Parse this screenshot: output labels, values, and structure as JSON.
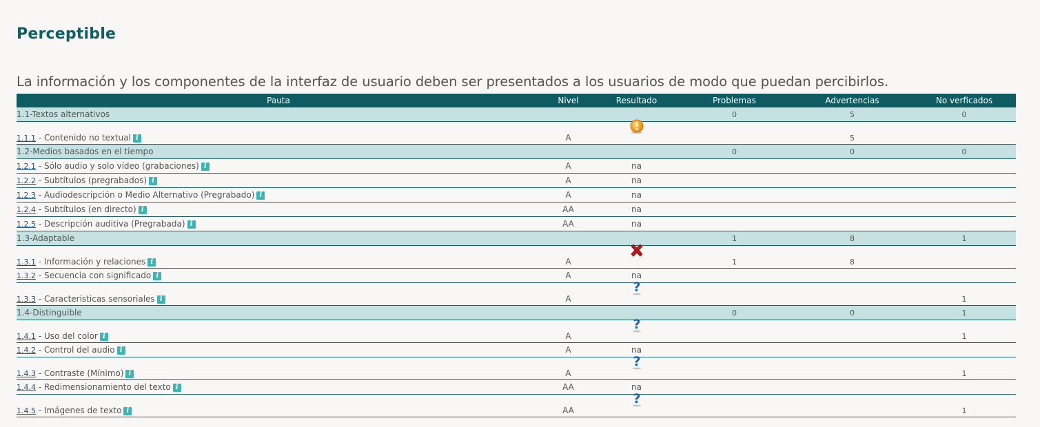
{
  "section": {
    "title": "Perceptible",
    "description": "La información y los componentes de la interfaz de usuario deben ser presentados a los usuarios de modo que puedan percibirlos."
  },
  "columns": {
    "pauta": "Pauta",
    "nivel": "Nivel",
    "resultado": "Resultado",
    "problemas": "Problemas",
    "advertencias": "Advertencias",
    "no_verificados": "No verficados"
  },
  "groups": [
    {
      "label": "1.1-Textos alternativos",
      "problemas": "0",
      "advertencias": "5",
      "no_verificados": "0",
      "items": [
        {
          "code": "1.1.1",
          "label": " - Contenido no textual",
          "nivel": "A",
          "resultado_icon": "warning-icon",
          "problemas": "",
          "advertencias": "5",
          "no_verificados": "",
          "tall": true
        }
      ]
    },
    {
      "label": "1.2-Medios basados en el tiempo",
      "problemas": "0",
      "advertencias": "0",
      "no_verificados": "0",
      "items": [
        {
          "code": "1.2.1",
          "label": " - Sólo audio y solo vídeo (grabaciones)",
          "nivel": "A",
          "resultado": "na",
          "problemas": "",
          "advertencias": "",
          "no_verificados": ""
        },
        {
          "code": "1.2.2",
          "label": " - Subtítulos (pregrabados)",
          "nivel": "A",
          "resultado": "na",
          "problemas": "",
          "advertencias": "",
          "no_verificados": ""
        },
        {
          "code": "1.2.3",
          "label": " - Audiodescripción o Medio Alternativo (Pregrabado)",
          "nivel": "A",
          "resultado": "na",
          "problemas": "",
          "advertencias": "",
          "no_verificados": ""
        },
        {
          "code": "1.2.4",
          "label": " - Subtítulos (en directo)",
          "nivel": "AA",
          "resultado": "na",
          "problemas": "",
          "advertencias": "",
          "no_verificados": ""
        },
        {
          "code": "1.2.5",
          "label": " - Descripción auditiva (Pregrabada)",
          "nivel": "AA",
          "resultado": "na",
          "problemas": "",
          "advertencias": "",
          "no_verificados": ""
        }
      ]
    },
    {
      "label": "1.3-Adaptable",
      "problemas": "1",
      "advertencias": "8",
      "no_verificados": "1",
      "items": [
        {
          "code": "1.3.1",
          "label": " - Información y relaciones",
          "nivel": "A",
          "resultado_icon": "fail-x-icon",
          "problemas": "1",
          "advertencias": "8",
          "no_verificados": "",
          "tall": true
        },
        {
          "code": "1.3.2",
          "label": " - Secuencia con significado",
          "nivel": "A",
          "resultado": "na",
          "problemas": "",
          "advertencias": "",
          "no_verificados": ""
        },
        {
          "code": "1.3.3",
          "label": " - Características sensoriales",
          "nivel": "A",
          "resultado_icon": "question-icon",
          "problemas": "",
          "advertencias": "",
          "no_verificados": "1",
          "tall": true
        }
      ]
    },
    {
      "label": "1.4-Distinguible",
      "problemas": "0",
      "advertencias": "0",
      "no_verificados": "1",
      "items": [
        {
          "code": "1.4.1",
          "label": " - Uso del color",
          "nivel": "A",
          "resultado_icon": "question-icon",
          "problemas": "",
          "advertencias": "",
          "no_verificados": "1",
          "tall": true
        },
        {
          "code": "1.4.2",
          "label": " - Control del audio",
          "nivel": "A",
          "resultado": "na",
          "problemas": "",
          "advertencias": "",
          "no_verificados": ""
        },
        {
          "code": "1.4.3",
          "label": " - Contraste (Mínimo)",
          "nivel": "A",
          "resultado_icon": "question-icon",
          "problemas": "",
          "advertencias": "",
          "no_verificados": "1",
          "tall": true
        },
        {
          "code": "1.4.4",
          "label": " - Redimensionamiento del texto",
          "nivel": "AA",
          "resultado": "na",
          "problemas": "",
          "advertencias": "",
          "no_verificados": ""
        },
        {
          "code": "1.4.5",
          "label": " - Imágenes de texto",
          "nivel": "AA",
          "resultado_icon": "question-icon",
          "problemas": "",
          "advertencias": "",
          "no_verificados": "1",
          "tall": true
        }
      ]
    }
  ],
  "info_icon_glyph": "i",
  "colors": {
    "header_bg": "#0f5b62",
    "group_bg": "#c6e1e2",
    "title": "#0f5e63",
    "info_icon": "#3db4b5"
  }
}
